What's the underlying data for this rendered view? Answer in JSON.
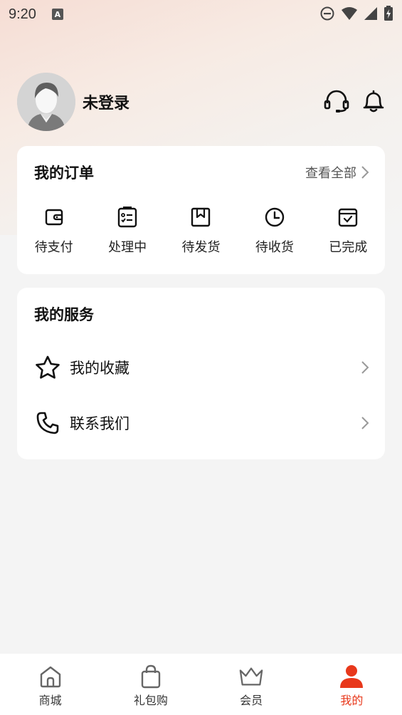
{
  "status_bar": {
    "time": "9:20",
    "notif_icon": "A"
  },
  "profile": {
    "username": "未登录"
  },
  "orders": {
    "title": "我的订单",
    "view_all": "查看全部",
    "items": [
      {
        "label": "待支付",
        "icon": "wallet-icon"
      },
      {
        "label": "处理中",
        "icon": "checklist-icon"
      },
      {
        "label": "待发货",
        "icon": "bookmark-box-icon"
      },
      {
        "label": "待收货",
        "icon": "clock-icon"
      },
      {
        "label": "已完成",
        "icon": "calendar-check-icon"
      }
    ]
  },
  "services": {
    "title": "我的服务",
    "items": [
      {
        "label": "我的收藏",
        "icon": "star-icon"
      },
      {
        "label": "联系我们",
        "icon": "phone-icon"
      }
    ]
  },
  "tabbar": {
    "items": [
      {
        "label": "商城",
        "icon": "home-icon"
      },
      {
        "label": "礼包购",
        "icon": "bag-icon"
      },
      {
        "label": "会员",
        "icon": "crown-icon"
      },
      {
        "label": "我的",
        "icon": "user-icon"
      }
    ],
    "active_index": 3,
    "active_color": "#e8381b"
  }
}
